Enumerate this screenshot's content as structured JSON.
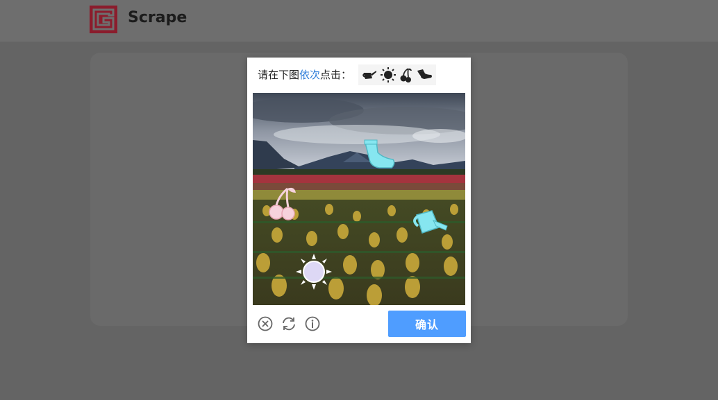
{
  "app": {
    "brand": "Scrape"
  },
  "captcha": {
    "prompt_prefix": "请在下图",
    "prompt_highlight": "依次",
    "prompt_suffix": "点击：",
    "targets": [
      "watering-can-icon",
      "sun-icon",
      "cherries-icon",
      "sock-icon"
    ],
    "image_symbols": [
      "sock-icon",
      "cherries-icon",
      "watering-can-icon",
      "sun-icon"
    ],
    "confirm_label": "确认"
  },
  "colors": {
    "accent": "#4f9dff",
    "highlight": "#2b7bd9",
    "logo": "#8b1c2c",
    "overlay": "#646464"
  }
}
